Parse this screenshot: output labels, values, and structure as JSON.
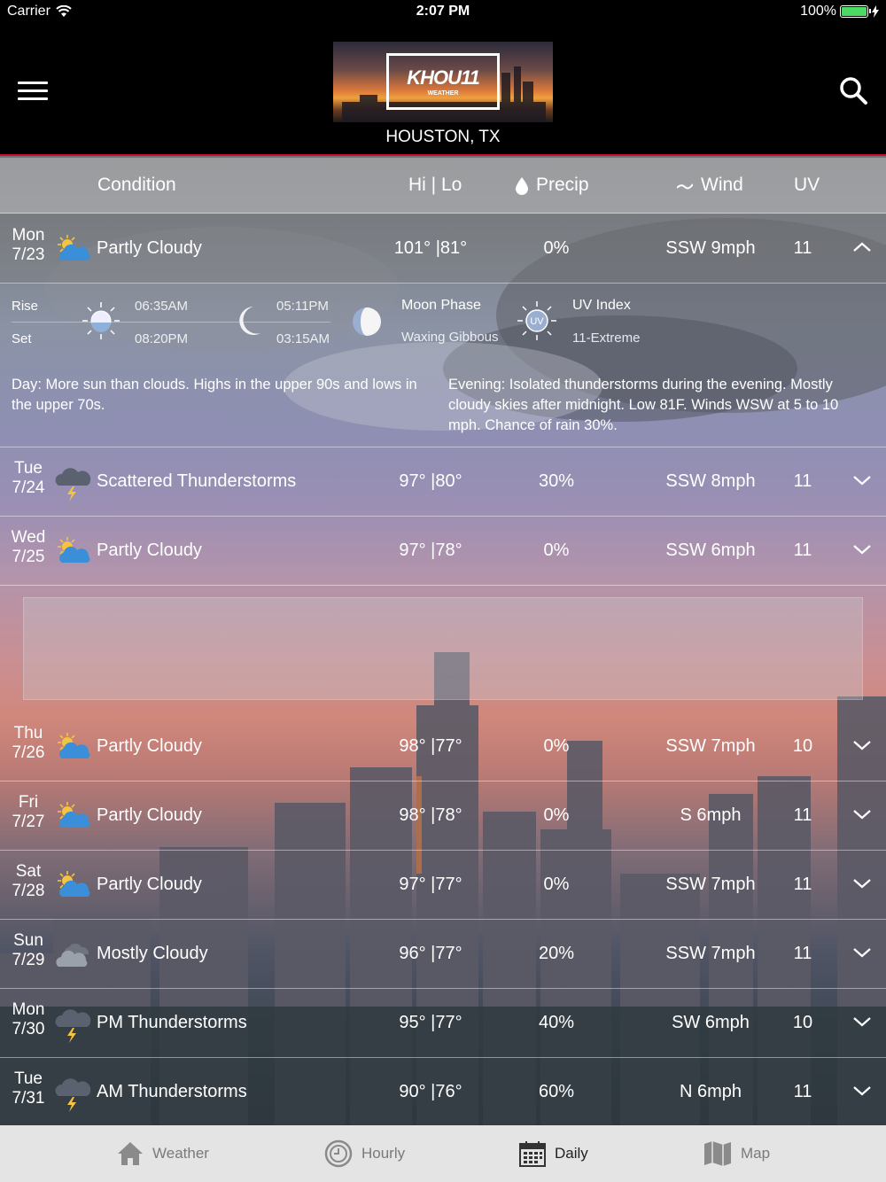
{
  "status_bar": {
    "carrier": "Carrier",
    "time": "2:07 PM",
    "battery": "100%"
  },
  "header": {
    "logo_text": "KHOU11",
    "logo_sub": "WEATHER",
    "location": "HOUSTON, TX"
  },
  "columns": {
    "condition": "Condition",
    "hilo": "Hi | Lo",
    "precip": "Precip",
    "wind": "Wind",
    "uv": "UV"
  },
  "days": [
    {
      "day": "Mon",
      "date": "7/23",
      "icon": "partly-cloudy-icon",
      "condition": "Partly Cloudy",
      "hilo": "101° |81°",
      "precip": "0%",
      "wind": "SSW 9mph",
      "uv": "11",
      "expanded": true
    },
    {
      "day": "Tue",
      "date": "7/24",
      "icon": "thunderstorm-icon",
      "condition": "Scattered Thunderstorms",
      "hilo": "97° |80°",
      "precip": "30%",
      "wind": "SSW 8mph",
      "uv": "11"
    },
    {
      "day": "Wed",
      "date": "7/25",
      "icon": "partly-cloudy-icon",
      "condition": "Partly Cloudy",
      "hilo": "97° |78°",
      "precip": "0%",
      "wind": "SSW 6mph",
      "uv": "11"
    },
    {
      "day": "Thu",
      "date": "7/26",
      "icon": "partly-cloudy-icon",
      "condition": "Partly Cloudy",
      "hilo": "98° |77°",
      "precip": "0%",
      "wind": "SSW 7mph",
      "uv": "10"
    },
    {
      "day": "Fri",
      "date": "7/27",
      "icon": "partly-cloudy-icon",
      "condition": "Partly Cloudy",
      "hilo": "98° |78°",
      "precip": "0%",
      "wind": "S 6mph",
      "uv": "11"
    },
    {
      "day": "Sat",
      "date": "7/28",
      "icon": "partly-cloudy-icon",
      "condition": "Partly Cloudy",
      "hilo": "97° |77°",
      "precip": "0%",
      "wind": "SSW 7mph",
      "uv": "11"
    },
    {
      "day": "Sun",
      "date": "7/29",
      "icon": "mostly-cloudy-icon",
      "condition": "Mostly Cloudy",
      "hilo": "96° |77°",
      "precip": "20%",
      "wind": "SSW 7mph",
      "uv": "11"
    },
    {
      "day": "Mon",
      "date": "7/30",
      "icon": "thunderstorm-icon",
      "condition": "PM Thunderstorms",
      "hilo": "95° |77°",
      "precip": "40%",
      "wind": "SW 6mph",
      "uv": "10"
    },
    {
      "day": "Tue",
      "date": "7/31",
      "icon": "thunderstorm-icon",
      "condition": "AM Thunderstorms",
      "hilo": "90° |76°",
      "precip": "60%",
      "wind": "N 6mph",
      "uv": "11"
    }
  ],
  "details": {
    "rise_label": "Rise",
    "set_label": "Set",
    "sunrise": "06:35AM",
    "sunset": "08:20PM",
    "moonrise": "05:11PM",
    "moonset": "03:15AM",
    "moon_phase_label": "Moon Phase",
    "moon_phase": "Waxing Gibbous",
    "uv_label": "UV Index",
    "uv_value": "11-Extreme",
    "day_label": "Day",
    "day_text": ": More sun than clouds. Highs in the upper 90s and lows in the upper 70s.",
    "evening_label": "Evening",
    "evening_text": ": Isolated thunderstorms during the evening. Mostly cloudy skies after midnight. Low 81F. Winds WSW at 5 to 10 mph. Chance of rain 30%."
  },
  "tabs": [
    {
      "label": "Weather",
      "icon": "home-icon"
    },
    {
      "label": "Hourly",
      "icon": "clock-icon"
    },
    {
      "label": "Daily",
      "icon": "calendar-icon",
      "active": true
    },
    {
      "label": "Map",
      "icon": "map-icon"
    }
  ],
  "colors": {
    "accent_red": "#c8102e",
    "battery_green": "#4cd964",
    "sun_yellow": "#f5c242",
    "cloud_blue": "#3a8fd8"
  }
}
